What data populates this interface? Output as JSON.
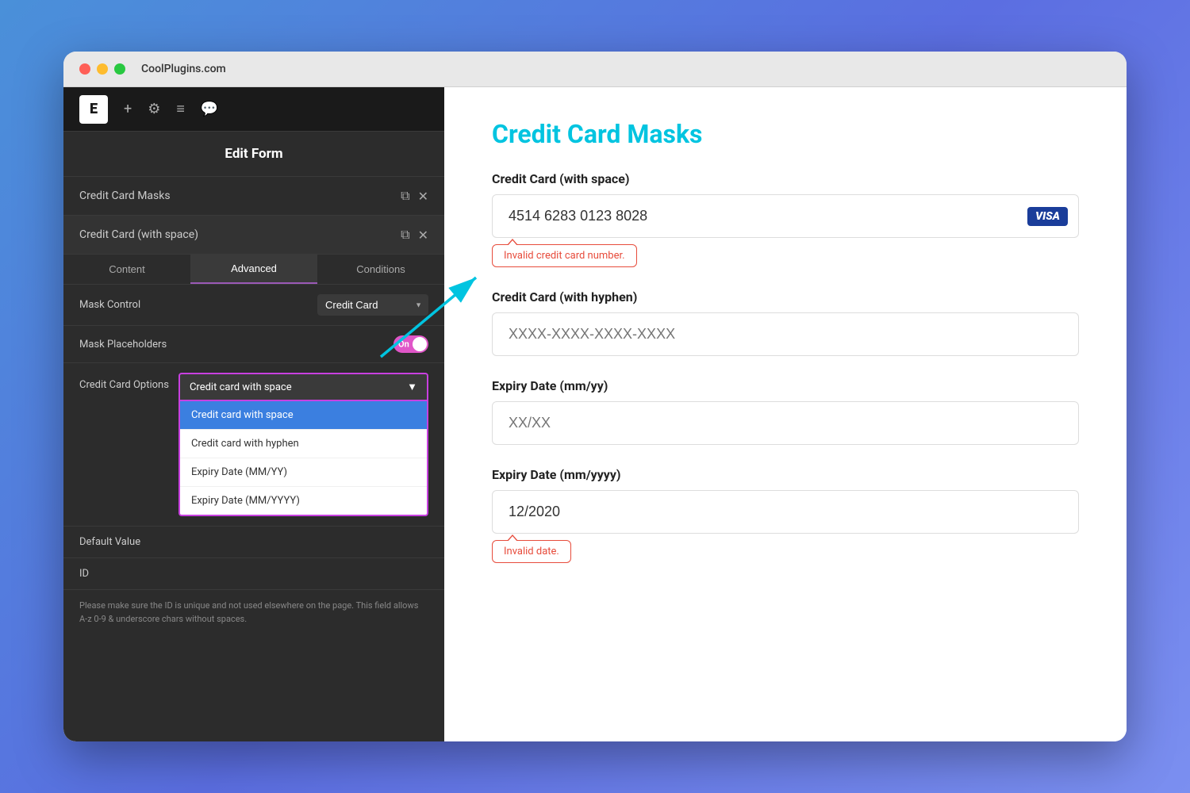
{
  "browser": {
    "url": "CoolPlugins.com",
    "traffic_lights": [
      "red",
      "yellow",
      "green"
    ]
  },
  "left_panel": {
    "logo": "E",
    "topbar_icons": [
      "+",
      "≡",
      "⊞",
      "⬛"
    ],
    "panel_title": "Edit Form",
    "section_items": [
      {
        "label": "Credit Card Masks"
      },
      {
        "label": "Credit Card (with space)"
      }
    ],
    "tabs": [
      "Content",
      "Advanced",
      "Conditions"
    ],
    "active_tab": "Advanced",
    "form_rows": [
      {
        "label": "Mask Control",
        "control_type": "select",
        "value": "Credit Card"
      },
      {
        "label": "Mask Placeholders",
        "control_type": "toggle",
        "value": "On"
      }
    ],
    "credit_card_options": {
      "label": "Credit Card Options",
      "selected": "Credit card with space",
      "options": [
        "Credit card with space",
        "Credit card with hyphen",
        "Expiry Date (MM/YY)",
        "Expiry Date (MM/YYYY)"
      ]
    },
    "extra_rows": [
      {
        "label": "Default Value"
      },
      {
        "label": "ID"
      }
    ],
    "help_text": "Please make sure the ID is unique and not used elsewhere on the page. This field allows A-z  0-9 & underscore chars without spaces."
  },
  "right_panel": {
    "page_title": "Credit Card Masks",
    "fields": [
      {
        "label": "Credit Card (with space)",
        "value": "4514 6283 0123 8028",
        "placeholder": "",
        "has_visa": true,
        "visa_text": "VISA",
        "has_error": true,
        "error_text": "Invalid credit card number."
      },
      {
        "label": "Credit Card (with hyphen)",
        "value": "XXXX-XXXX-XXXX-XXXX",
        "placeholder": "XXXX-XXXX-XXXX-XXXX",
        "has_visa": false,
        "has_error": false
      },
      {
        "label": "Expiry Date (mm/yy)",
        "value": "XX/XX",
        "placeholder": "XX/XX",
        "has_visa": false,
        "has_error": false
      },
      {
        "label": "Expiry Date (mm/yyyy)",
        "value": "12/2020",
        "placeholder": "",
        "has_visa": false,
        "has_error": true,
        "error_text": "Invalid date."
      }
    ]
  }
}
